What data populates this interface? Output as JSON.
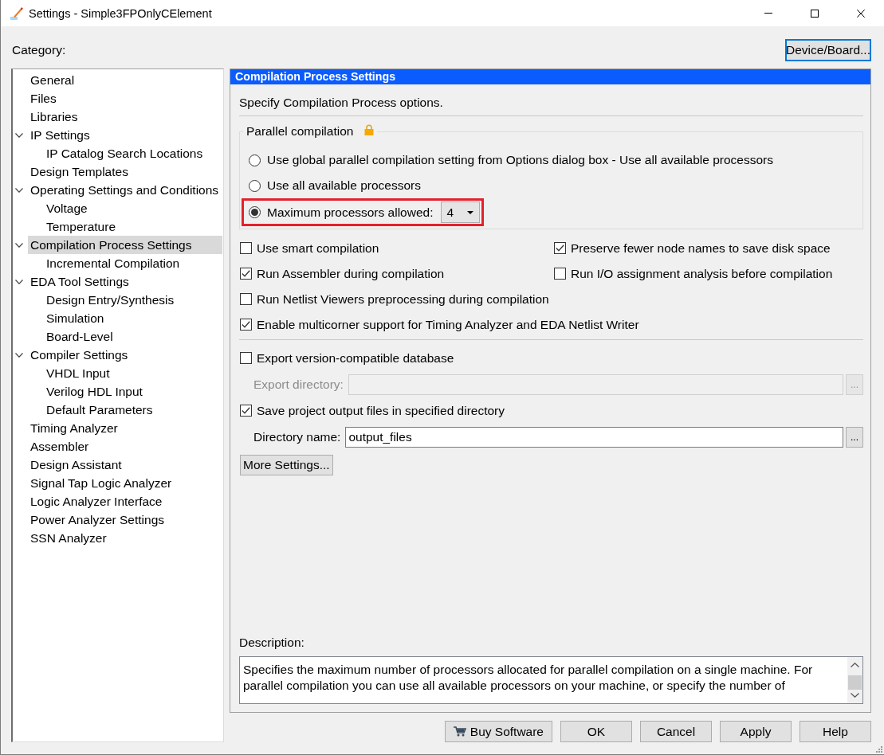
{
  "window": {
    "title": "Settings - Simple3FPOnlyCElement"
  },
  "category": {
    "label": "Category:",
    "items": [
      {
        "label": "General",
        "selected": false
      },
      {
        "label": "Files",
        "selected": false
      },
      {
        "label": "Libraries",
        "selected": false
      },
      {
        "label": "IP Settings",
        "selected": false,
        "expanded": true,
        "children": [
          {
            "label": "IP Catalog Search Locations",
            "selected": false
          }
        ]
      },
      {
        "label": "Design Templates",
        "selected": false
      },
      {
        "label": "Operating Settings and Conditions",
        "selected": false,
        "expanded": true,
        "children": [
          {
            "label": "Voltage",
            "selected": false
          },
          {
            "label": "Temperature",
            "selected": false
          }
        ]
      },
      {
        "label": "Compilation Process Settings",
        "selected": true,
        "expanded": true,
        "children": [
          {
            "label": "Incremental Compilation",
            "selected": false
          }
        ]
      },
      {
        "label": "EDA Tool Settings",
        "selected": false,
        "expanded": true,
        "children": [
          {
            "label": "Design Entry/Synthesis",
            "selected": false
          },
          {
            "label": "Simulation",
            "selected": false
          },
          {
            "label": "Board-Level",
            "selected": false
          }
        ]
      },
      {
        "label": "Compiler Settings",
        "selected": false,
        "expanded": true,
        "children": [
          {
            "label": "VHDL Input",
            "selected": false
          },
          {
            "label": "Verilog HDL Input",
            "selected": false
          },
          {
            "label": "Default Parameters",
            "selected": false
          }
        ]
      },
      {
        "label": "Timing Analyzer",
        "selected": false
      },
      {
        "label": "Assembler",
        "selected": false
      },
      {
        "label": "Design Assistant",
        "selected": false
      },
      {
        "label": "Signal Tap Logic Analyzer",
        "selected": false
      },
      {
        "label": "Logic Analyzer Interface",
        "selected": false
      },
      {
        "label": "Power Analyzer Settings",
        "selected": false
      },
      {
        "label": "SSN Analyzer",
        "selected": false
      }
    ]
  },
  "device_button": {
    "label": "Device/Board...",
    "focused": true
  },
  "panel": {
    "title": "Compilation Process Settings",
    "intro": "Specify Compilation Process options.",
    "parallel_compilation": {
      "title": "Parallel compilation",
      "locked": true,
      "options": [
        {
          "label": "Use global parallel compilation setting from Options dialog box - Use all available processors",
          "selected": false,
          "highlighted": false,
          "kind": "plain"
        },
        {
          "label": "Use all available processors",
          "selected": false,
          "highlighted": false,
          "kind": "plain"
        },
        {
          "label": "Maximum processors allowed:",
          "selected": true,
          "highlighted": true,
          "kind": "dropdown",
          "value": "4"
        }
      ]
    },
    "checkbox_rows": [
      [
        {
          "label": "Use smart compilation",
          "checked": false
        },
        {
          "label": "Preserve fewer node names to save disk space",
          "checked": true
        }
      ],
      [
        {
          "label": "Run Assembler during compilation",
          "checked": true
        },
        {
          "label": "Run I/O assignment analysis before compilation",
          "checked": false
        }
      ],
      [
        {
          "label": "Run Netlist Viewers preprocessing during compilation",
          "checked": false
        }
      ],
      [
        {
          "label": "Enable multicorner support for Timing Analyzer and EDA Netlist Writer",
          "checked": true
        }
      ]
    ],
    "export_database": {
      "label": "Export version-compatible database",
      "checked": false
    },
    "export_directory": {
      "label": "Export directory:",
      "disabled": true,
      "browse": "..."
    },
    "save_output": {
      "label": "Save project output files in specified directory",
      "checked": true
    },
    "directory_name": {
      "label": "Directory name:",
      "value": "output_files",
      "disabled": false,
      "browse": "..."
    },
    "more_settings": "More Settings...",
    "description": {
      "label": "Description:",
      "lines": [
        "Specifies the maximum number of processors allocated for parallel compilation on a single machine. For",
        "parallel compilation you can use all available processors on your machine, or specify the number of"
      ]
    }
  },
  "buttons": [
    {
      "label": "Buy Software",
      "kind": "cart"
    },
    {
      "label": "OK",
      "kind": "plain"
    },
    {
      "label": "Cancel",
      "kind": "plain"
    },
    {
      "label": "Apply",
      "kind": "plain"
    },
    {
      "label": "Help",
      "kind": "plain"
    }
  ]
}
